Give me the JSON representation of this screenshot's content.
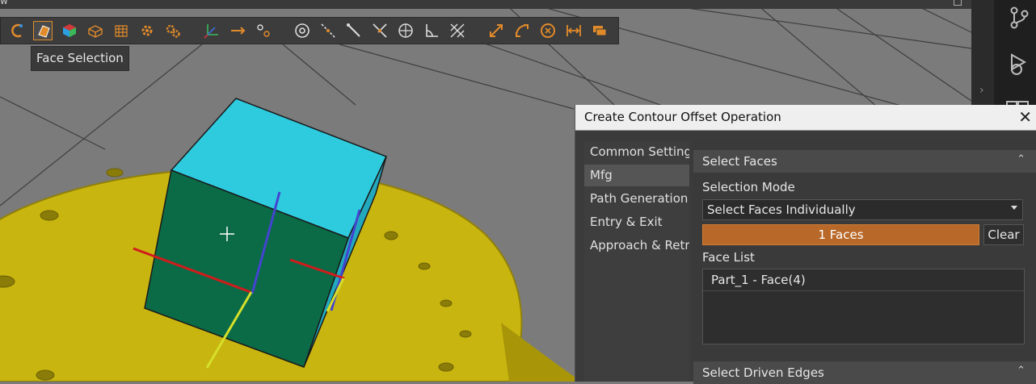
{
  "tooltip": "Face Selection",
  "title_strip": {
    "label": "w"
  },
  "toolbar": {
    "buttons": [
      {
        "icon": "magnet-icon"
      },
      {
        "icon": "face-selection-icon",
        "active": true
      },
      {
        "icon": "solid-body-icon"
      },
      {
        "icon": "wireframe-box-icon"
      },
      {
        "icon": "mesh-box-icon"
      },
      {
        "icon": "gear-icon"
      },
      {
        "icon": "gears-icon"
      },
      {
        "icon": "axes-icon"
      },
      {
        "icon": "arrow-right-icon"
      },
      {
        "icon": "points-icon"
      },
      {
        "icon": "circle-target-icon"
      },
      {
        "icon": "diagonal-line-icon"
      },
      {
        "icon": "line-segment-icon"
      },
      {
        "icon": "intersect-lines-icon"
      },
      {
        "icon": "circle-axes-icon"
      },
      {
        "icon": "angle-icon"
      },
      {
        "icon": "crosshatch-icon"
      },
      {
        "icon": "resize-diagonal-icon"
      },
      {
        "icon": "curve-resize-icon"
      },
      {
        "icon": "rotate-circle-icon"
      },
      {
        "icon": "width-arrows-icon"
      },
      {
        "icon": "stack-layers-icon"
      }
    ]
  },
  "dialog": {
    "title": "Create Contour Offset Operation",
    "nav": [
      "Common Setting",
      "Mfg",
      "Path Generation",
      "Entry & Exit",
      "Approach & Retr"
    ],
    "nav_selected": "Mfg",
    "select_faces": {
      "header": "Select Faces",
      "mode_label": "Selection Mode",
      "mode_value": "Select Faces Individually",
      "faces_button": "1 Faces",
      "clear_button": "Clear",
      "list_label": "Face List",
      "list_items": [
        "Part_1 - Face(4)"
      ]
    },
    "select_edges": {
      "header": "Select Driven Edges"
    }
  },
  "colors": {
    "accent": "#b8692a",
    "cube_top": "#2ecbdf",
    "cube_side": "#0b6b47",
    "table": "#c9b510",
    "ground": "#7a7a7a"
  }
}
